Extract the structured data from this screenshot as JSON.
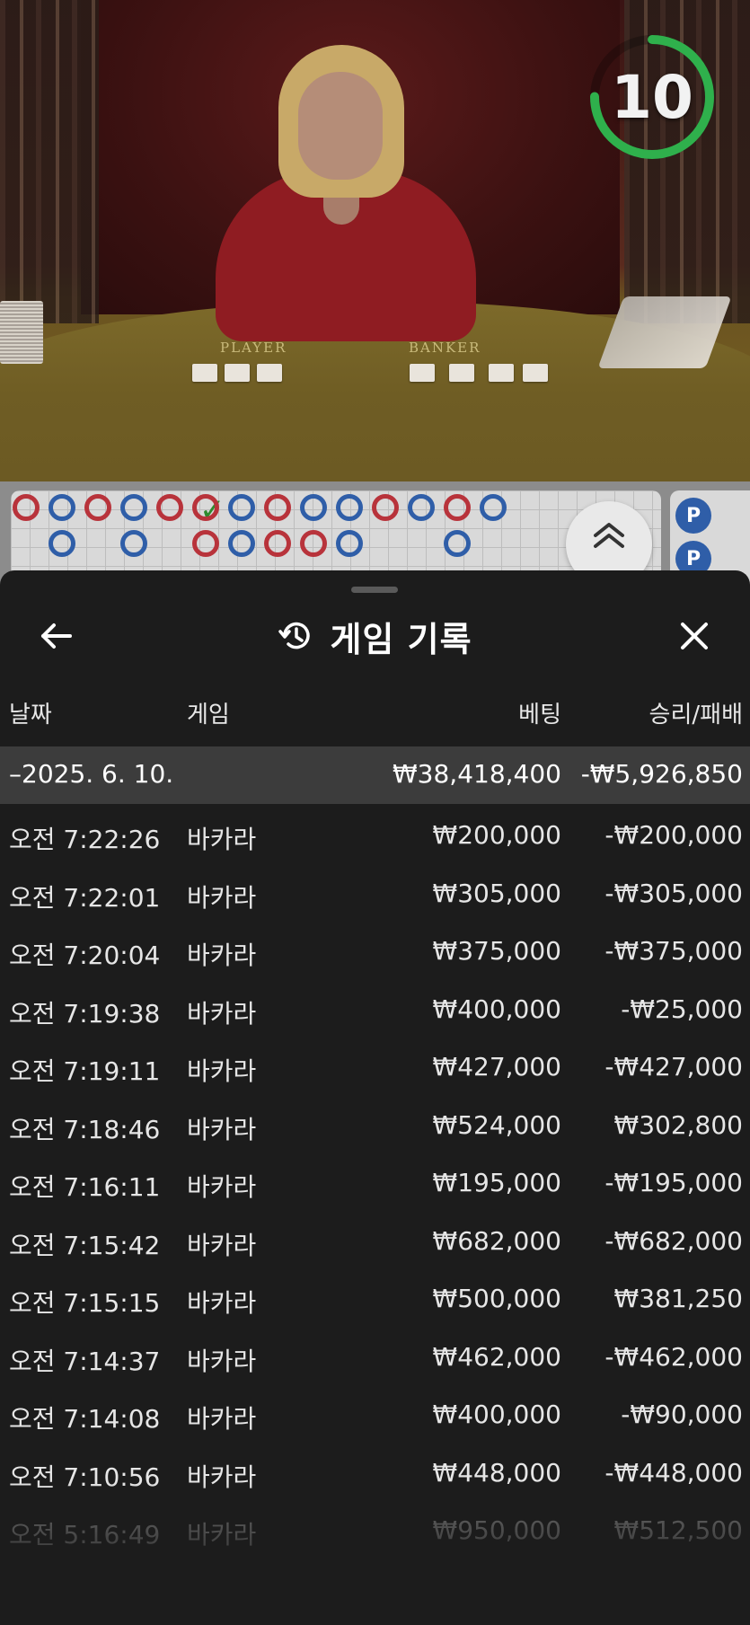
{
  "live": {
    "timer": "10",
    "felt_left": "PLAYER",
    "felt_right": "BANKER",
    "roadmap_p": "P"
  },
  "history": {
    "title": "게임 기록",
    "columns": {
      "date": "날짜",
      "game": "게임",
      "bet": "베팅",
      "result": "승리/패배"
    },
    "summary": {
      "date": "–2025. 6. 10.",
      "bet": "₩38,418,400",
      "result": "-₩5,926,850"
    },
    "rows": [
      {
        "time": "오전 7:22:26",
        "game": "바카라",
        "bet": "₩200,000",
        "result": "-₩200,000"
      },
      {
        "time": "오전 7:22:01",
        "game": "바카라",
        "bet": "₩305,000",
        "result": "-₩305,000"
      },
      {
        "time": "오전 7:20:04",
        "game": "바카라",
        "bet": "₩375,000",
        "result": "-₩375,000"
      },
      {
        "time": "오전 7:19:38",
        "game": "바카라",
        "bet": "₩400,000",
        "result": "-₩25,000"
      },
      {
        "time": "오전 7:19:11",
        "game": "바카라",
        "bet": "₩427,000",
        "result": "-₩427,000"
      },
      {
        "time": "오전 7:18:46",
        "game": "바카라",
        "bet": "₩524,000",
        "result": "₩302,800"
      },
      {
        "time": "오전 7:16:11",
        "game": "바카라",
        "bet": "₩195,000",
        "result": "-₩195,000"
      },
      {
        "time": "오전 7:15:42",
        "game": "바카라",
        "bet": "₩682,000",
        "result": "-₩682,000"
      },
      {
        "time": "오전 7:15:15",
        "game": "바카라",
        "bet": "₩500,000",
        "result": "₩381,250"
      },
      {
        "time": "오전 7:14:37",
        "game": "바카라",
        "bet": "₩462,000",
        "result": "-₩462,000"
      },
      {
        "time": "오전 7:14:08",
        "game": "바카라",
        "bet": "₩400,000",
        "result": "-₩90,000"
      },
      {
        "time": "오전 7:10:56",
        "game": "바카라",
        "bet": "₩448,000",
        "result": "-₩448,000"
      },
      {
        "time": "오전 5:16:49",
        "game": "바카라",
        "bet": "₩950,000",
        "result": "₩512,500"
      }
    ]
  },
  "colors": {
    "sheet_bg": "#1c1c1c",
    "summary_bg": "#3c3c3c",
    "timer_green": "#2fb04c",
    "banker_red": "#b8333b",
    "player_blue": "#2f5ea8"
  },
  "icons": [
    "back-arrow-icon",
    "history-icon",
    "close-icon",
    "chevron-up-double-icon"
  ]
}
